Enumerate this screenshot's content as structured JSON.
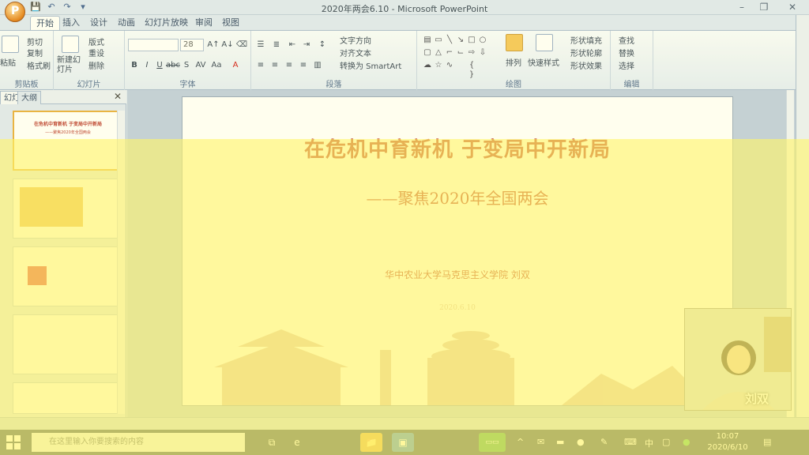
{
  "window": {
    "title": "2020年两会6.10 - Microsoft PowerPoint",
    "logo_letter": "P"
  },
  "tabs": [
    {
      "label": "开始",
      "active": true
    },
    {
      "label": "插入"
    },
    {
      "label": "设计"
    },
    {
      "label": "动画"
    },
    {
      "label": "幻灯片放映"
    },
    {
      "label": "审阅"
    },
    {
      "label": "视图"
    }
  ],
  "ribbon": {
    "clipboard": {
      "cut": "剪切",
      "copy": "复制",
      "format_painter": "格式刷",
      "paste": "粘贴",
      "label": "剪贴板"
    },
    "slides": {
      "new_slide": "新建幻灯片",
      "layout": "版式",
      "reset": "重设",
      "delete": "删除",
      "label": "幻灯片"
    },
    "font": {
      "size": "28",
      "label": "字体"
    },
    "paragraph": {
      "text_direction": "文字方向",
      "align_text": "对齐文本",
      "smartart": "转换为 SmartArt",
      "label": "段落"
    },
    "drawing": {
      "arrange": "排列",
      "quick_styles": "快速样式",
      "shape_fill": "形状填充",
      "shape_outline": "形状轮廓",
      "shape_effects": "形状效果",
      "label": "绘图"
    },
    "editing": {
      "find": "查找",
      "replace": "替换",
      "select": "选择",
      "label": "编辑"
    }
  },
  "left_pane": {
    "tab_slides": "幻灯片",
    "tab_outline": "大纲",
    "thumb1_title": "在危机中育新机  于变局中开新局",
    "thumb1_sub": "——聚焦2020年全国两会"
  },
  "slide": {
    "title": "在危机中育新机  于变局中开新局",
    "subtitle": "——聚焦2020年全国两会",
    "author": "华中农业大学马克思主义学院    刘双",
    "date": "2020.6.10"
  },
  "webcam": {
    "name": "刘双"
  },
  "taskbar": {
    "search_placeholder": "在这里输入你要搜索的内容",
    "time": "10:07",
    "date": "2020/6/10",
    "ime": "中"
  },
  "colors": {
    "slide_red": "#b3261e",
    "glare": "#fff56e"
  }
}
